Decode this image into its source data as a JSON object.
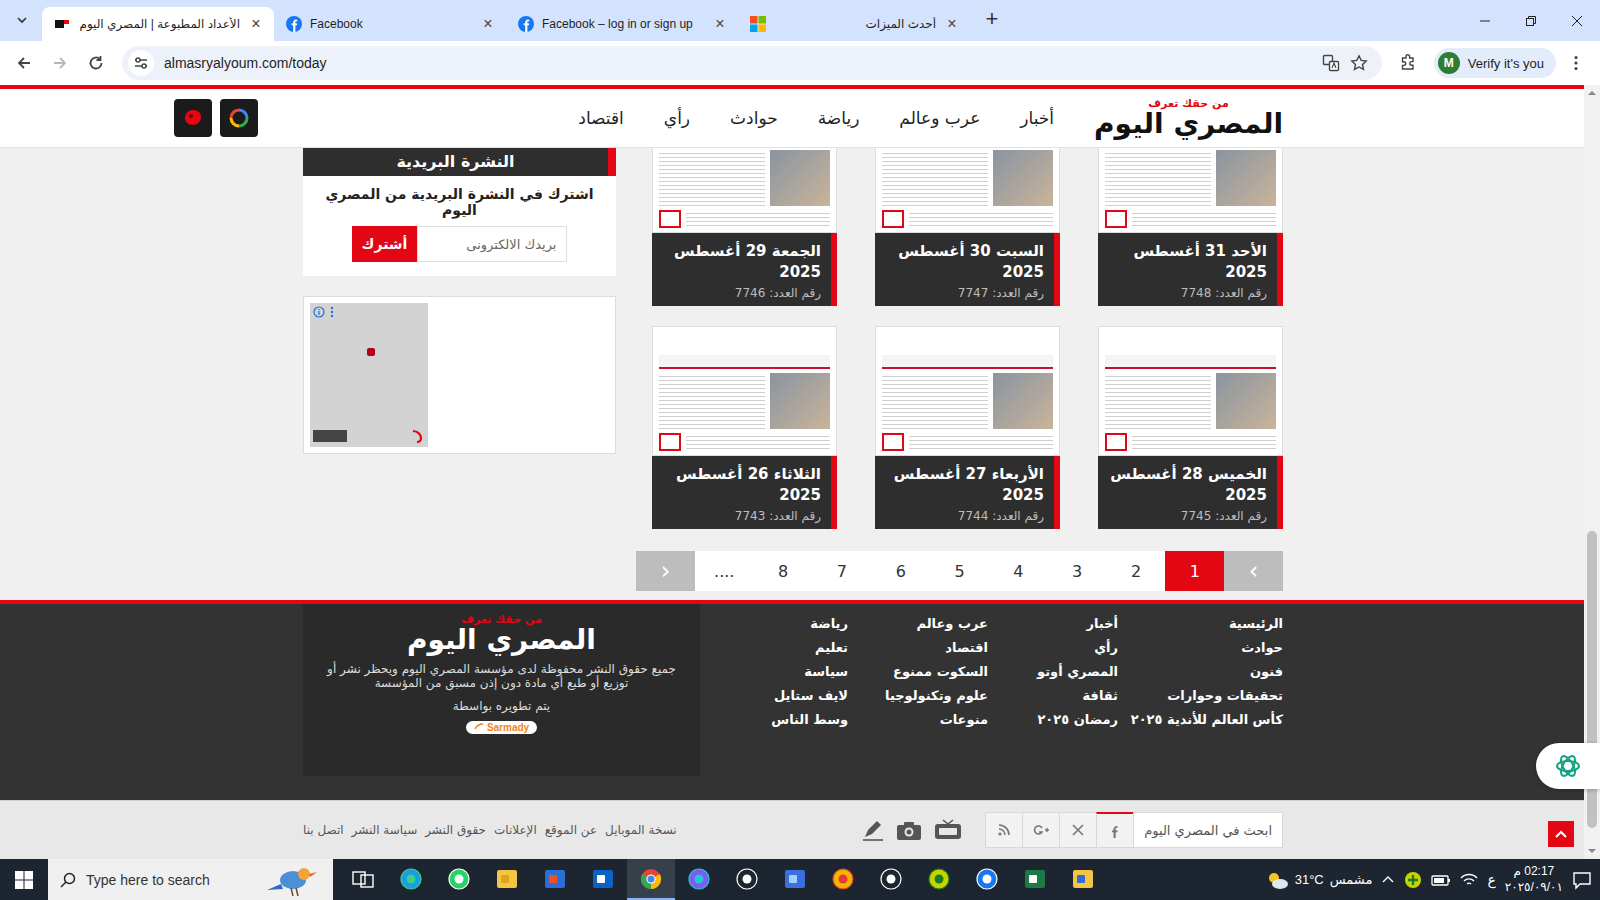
{
  "browser": {
    "tabs": [
      {
        "label": "الأعداد المطبوعة | المصري اليوم",
        "kind": "site",
        "selected": true
      },
      {
        "label": "Facebook",
        "kind": "facebook",
        "selected": false
      },
      {
        "label": "Facebook – log in or sign up",
        "kind": "facebook",
        "selected": false
      },
      {
        "label": "أحدث الميزات",
        "kind": "microsoft",
        "selected": false
      }
    ],
    "close_glyph": "×",
    "new_tab_glyph": "+",
    "forward_disabled": true,
    "url": "almasryalyoum.com/today",
    "profile": {
      "initial": "M",
      "label": "Verify it's you"
    }
  },
  "site": {
    "logo": {
      "name": "المصري اليوم",
      "tagline": "من حقك تعرف"
    },
    "nav": [
      "أخبار",
      "عرب وعالم",
      "رياضة",
      "حوادث",
      "رأي",
      "اقتصاد"
    ],
    "newsletter": {
      "title": "النشرة البريدية",
      "text": "اشترك في النشرة البريدية من المصري اليوم",
      "placeholder": "بريدك الالكترونى",
      "button": "أشترك"
    },
    "issues": [
      {
        "title": "الأحد 31 أغسطس 2025",
        "number": "رقم العدد: 7748"
      },
      {
        "title": "السبت 30 أغسطس 2025",
        "number": "رقم العدد: 7747"
      },
      {
        "title": "الجمعة 29 أغسطس 2025",
        "number": "رقم العدد: 7746"
      },
      {
        "title": "الخميس 28 أغسطس 2025",
        "number": "رقم العدد: 7745"
      },
      {
        "title": "الأربعاء 27 أغسطس 2025",
        "number": "رقم العدد: 7744"
      },
      {
        "title": "الثلاثاء 26 أغسطس 2025",
        "number": "رقم العدد: 7743"
      }
    ],
    "pagination": {
      "first": "›",
      "last": "‹",
      "pages": [
        {
          "label": "1",
          "selected": true
        },
        {
          "label": "2",
          "selected": false
        },
        {
          "label": "3",
          "selected": false
        },
        {
          "label": "4",
          "selected": false
        },
        {
          "label": "5",
          "selected": false
        },
        {
          "label": "6",
          "selected": false
        },
        {
          "label": "7",
          "selected": false
        },
        {
          "label": "8",
          "selected": false
        },
        {
          "label": "....",
          "selected": false
        }
      ]
    },
    "footer": {
      "columns": [
        [
          "الرئيسية",
          "حوادث",
          "فنون",
          "تحقيقات وحوارات",
          "كأس العالم للأندية ٢٠٢٥"
        ],
        [
          "أخبار",
          "رأي",
          "المصري أوتو",
          "ثقافة",
          "رمضان ٢٠٢٥"
        ],
        [
          "عرب وعالم",
          "اقتصاد",
          "السكوت ممنوع",
          "علوم وتكنولوجيا",
          "منوعات"
        ],
        [
          "رياضة",
          "تعليم",
          "سياسة",
          "لايف ستايل",
          "وسط الناس"
        ]
      ],
      "copyright": "جميع حقوق النشر محفوظة لدى مؤسسة المصري اليوم ويحظر نشر أو توزيع أو طبع أي مادة دون إذن مسبق من المؤسسة",
      "developed_by": "يتم تطويره بواسطة",
      "developer": "Sarmady"
    },
    "bottom_bar": {
      "search_placeholder": "ابحث في المصري اليوم",
      "links": [
        "نسخة الموبايل",
        "عن الموقع",
        "الإعلانات",
        "حقوق النشر",
        "سياسة النشر",
        "اتصل بنا"
      ]
    },
    "scroll": {
      "offset": 0.58,
      "visible_share": 0.4
    }
  },
  "taskbar": {
    "search_placeholder": "Type here to search",
    "apps": [
      {
        "kind": "taskview",
        "active": false
      },
      {
        "kind": "edge",
        "active": false
      },
      {
        "kind": "whatsapp",
        "active": false
      },
      {
        "kind": "explorer",
        "active": false
      },
      {
        "kind": "store",
        "active": false
      },
      {
        "kind": "outlook",
        "active": false
      },
      {
        "kind": "chrome",
        "active": true
      },
      {
        "kind": "copilot",
        "active": false
      },
      {
        "kind": "chatgpt",
        "active": false
      },
      {
        "kind": "assistant",
        "active": false
      },
      {
        "kind": "colorwheel",
        "active": false
      },
      {
        "kind": "settings",
        "active": false
      },
      {
        "kind": "plus",
        "active": false
      },
      {
        "kind": "facebook",
        "active": false
      },
      {
        "kind": "excel",
        "active": false
      },
      {
        "kind": "files",
        "active": false
      }
    ],
    "temperature": "31°C",
    "weather": "مشمس",
    "language": "ع",
    "time": "02:17 م",
    "date": "٢٠٢٥/٠٩/٠١"
  }
}
